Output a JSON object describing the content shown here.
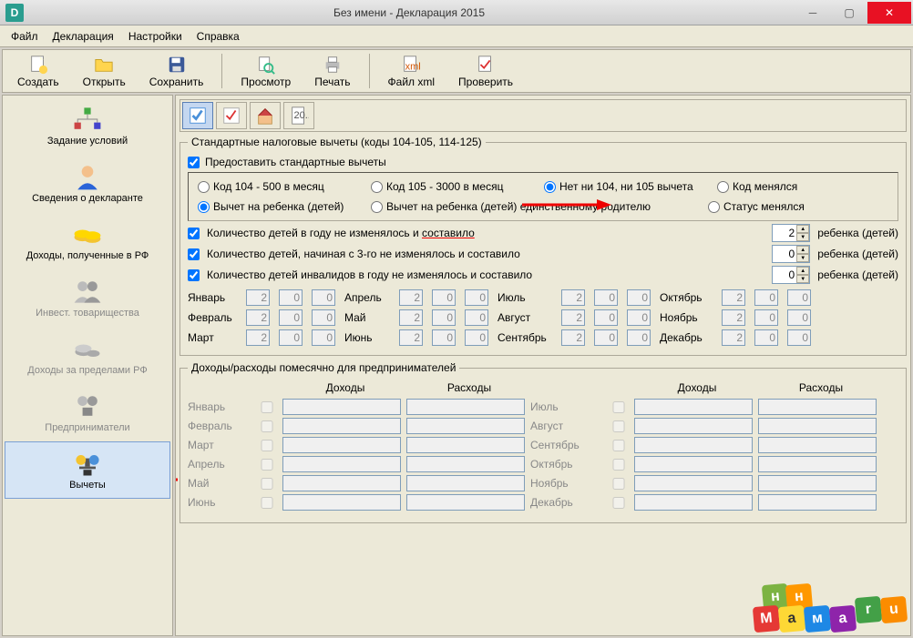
{
  "window": {
    "title": "Без имени - Декларация 2015"
  },
  "menu": [
    "Файл",
    "Декларация",
    "Настройки",
    "Справка"
  ],
  "toolbar": {
    "create": "Создать",
    "open": "Открыть",
    "save": "Сохранить",
    "preview": "Просмотр",
    "print": "Печать",
    "xml": "Файл xml",
    "check": "Проверить"
  },
  "sidebar": {
    "items": [
      {
        "label": "Задание условий",
        "icon": "tree-icon",
        "disabled": false
      },
      {
        "label": "Сведения о декларанте",
        "icon": "person-icon",
        "disabled": false
      },
      {
        "label": "Доходы, полученные в РФ",
        "icon": "coins-icon",
        "disabled": false
      },
      {
        "label": "Инвест. товарищества",
        "icon": "partner-icon",
        "disabled": true
      },
      {
        "label": "Доходы за пределами РФ",
        "icon": "coins-gray-icon",
        "disabled": true
      },
      {
        "label": "Предприниматели",
        "icon": "brief-icon",
        "disabled": true
      },
      {
        "label": "Вычеты",
        "icon": "deduct-icon",
        "disabled": false,
        "selected": true
      }
    ]
  },
  "standard": {
    "legend": "Стандартные налоговые вычеты (коды 104-105, 114-125)",
    "provide": "Предоставить стандартные вычеты",
    "codes": {
      "c104": "Код 104 - 500 в месяц",
      "c105": "Код 105 - 3000 в месяц",
      "none": "Нет ни 104, ни 105 вычета",
      "changed": "Код менялся"
    },
    "child_type": {
      "child": "Вычет на ребенка (детей)",
      "single": "Вычет на ребенка (детей) единственному родителю",
      "status": "Статус менялся"
    },
    "children_rows": [
      {
        "label": "Количество детей в году не изменялось и составило",
        "value": "2",
        "suffix": "ребенка (детей)",
        "checked": true
      },
      {
        "label": "Количество детей, начиная с 3-го не изменялось и составило",
        "value": "0",
        "suffix": "ребенка (детей)",
        "checked": true
      },
      {
        "label": "Количество детей инвалидов в году не изменялось и составило",
        "value": "0",
        "suffix": "ребенка (детей)",
        "checked": true
      }
    ],
    "months": {
      "jan": "Январь",
      "feb": "Февраль",
      "mar": "Март",
      "apr": "Апрель",
      "may": "Май",
      "jun": "Июнь",
      "jul": "Июль",
      "aug": "Август",
      "sep": "Сентябрь",
      "oct": "Октябрь",
      "nov": "Ноябрь",
      "dec": "Декабрь"
    },
    "month_value": "2",
    "month_zero": "0"
  },
  "entrep": {
    "legend": "Доходы/расходы помесячно для предпринимателей",
    "income": "Доходы",
    "expense": "Расходы",
    "rows": [
      {
        "m1": "Январь",
        "m2": "Июль"
      },
      {
        "m1": "Февраль",
        "m2": "Август"
      },
      {
        "m1": "Март",
        "m2": "Сентябрь"
      },
      {
        "m1": "Апрель",
        "m2": "Октябрь"
      },
      {
        "m1": "Май",
        "m2": "Ноябрь"
      },
      {
        "m1": "Июнь",
        "m2": "Декабрь"
      }
    ]
  }
}
